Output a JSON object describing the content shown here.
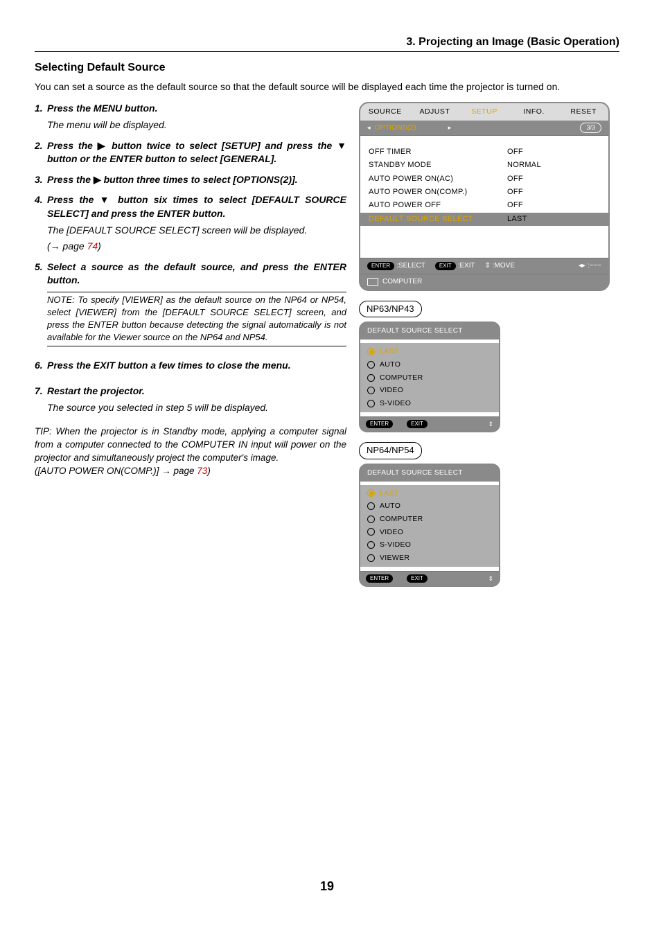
{
  "breadcrumb": "3. Projecting an Image (Basic Operation)",
  "heading": "Selecting Default Source",
  "intro": "You can set a source as the default source so that the default source will be displayed each time the projector is turned on.",
  "steps": {
    "s1": {
      "num": "1.",
      "main": "Press the MENU button.",
      "sub": "The menu will be displayed."
    },
    "s2": {
      "num": "2.",
      "main_a": "Press the ",
      "tri_r": "▶",
      "main_b": " button twice to select [SETUP] and press the ",
      "tri_d": "▼",
      "main_c": " button or the ENTER button to select [GENERAL]."
    },
    "s3": {
      "num": "3.",
      "main_a": "Press the ",
      "tri_r": "▶",
      "main_b": " button three times to select [OPTIONS(2)]."
    },
    "s4": {
      "num": "4.",
      "main_a": "Press the ",
      "tri_d": "▼",
      "main_b": " button six times to select [DEFAULT SOURCE SELECT] and press the ENTER button.",
      "sub": "The [DEFAULT SOURCE SELECT] screen will be displayed.",
      "pagelink_pre": "(→ page ",
      "pagelink": "74",
      "pagelink_post": ")"
    },
    "s5": {
      "num": "5.",
      "main": "Select a source as the default source, and press the ENTER button.",
      "note": "NOTE: To specify [VIEWER] as the default source on the NP64 or NP54, select [VIEWER] from the [DEFAULT SOURCE SELECT] screen, and press the ENTER button because detecting the signal automatically is not available for the Viewer source on the NP64 and NP54."
    },
    "s6": {
      "num": "6.",
      "main": "Press the EXIT button a few times to close the menu."
    },
    "s7": {
      "num": "7.",
      "main": "Restart the projector.",
      "sub": "The source you selected in step 5 will be displayed."
    }
  },
  "tip": "TIP: When the projector is in Standby mode, applying a computer signal from a computer connected to the COMPUTER IN input will power on the projector and simultaneously project the computer's image.",
  "tipline_a": "([AUTO POWER ON(COMP.)] → page ",
  "tipline_link": "73",
  "tipline_b": ")",
  "osd": {
    "tabs": {
      "t1": "SOURCE",
      "t2": "ADJUST",
      "t3": "SETUP",
      "t4": "INFO.",
      "t5": "RESET"
    },
    "subtab": "OPTIONS(2)",
    "pagebadge": "3/3",
    "rows": {
      "r1": {
        "label": "OFF TIMER",
        "val": "OFF"
      },
      "r2": {
        "label": "STANDBY MODE",
        "val": "NORMAL"
      },
      "r3": {
        "label": "AUTO POWER ON(AC)",
        "val": "OFF"
      },
      "r4": {
        "label": "AUTO POWER ON(COMP.)",
        "val": "OFF"
      },
      "r5": {
        "label": "AUTO POWER OFF",
        "val": "OFF"
      },
      "r6": {
        "label": "DEFAULT SOURCE SELECT",
        "val": "LAST"
      }
    },
    "hint": {
      "enter_lbl": "ENTER",
      "select": ":SELECT",
      "exit_lbl": "EXIT",
      "exit": ":EXIT",
      "move": ":MOVE",
      "updown": "⇕",
      "lr_dashes": "◂▸  :−−−"
    },
    "src": "COMPUTER"
  },
  "model1": "NP63/NP43",
  "submenu1": {
    "title": "DEFAULT SOURCE SELECT",
    "items": {
      "i1": "LAST",
      "i2": "AUTO",
      "i3": "COMPUTER",
      "i4": "VIDEO",
      "i5": "S-VIDEO"
    },
    "hint": {
      "enter": "ENTER",
      "exit": "EXIT",
      "arrows": "⇕"
    }
  },
  "model2": "NP64/NP54",
  "submenu2": {
    "title": "DEFAULT SOURCE SELECT",
    "items": {
      "i1": "LAST",
      "i2": "AUTO",
      "i3": "COMPUTER",
      "i4": "VIDEO",
      "i5": "S-VIDEO",
      "i6": "VIEWER"
    },
    "hint": {
      "enter": "ENTER",
      "exit": "EXIT",
      "arrows": "⇕"
    }
  },
  "pagenum": "19"
}
